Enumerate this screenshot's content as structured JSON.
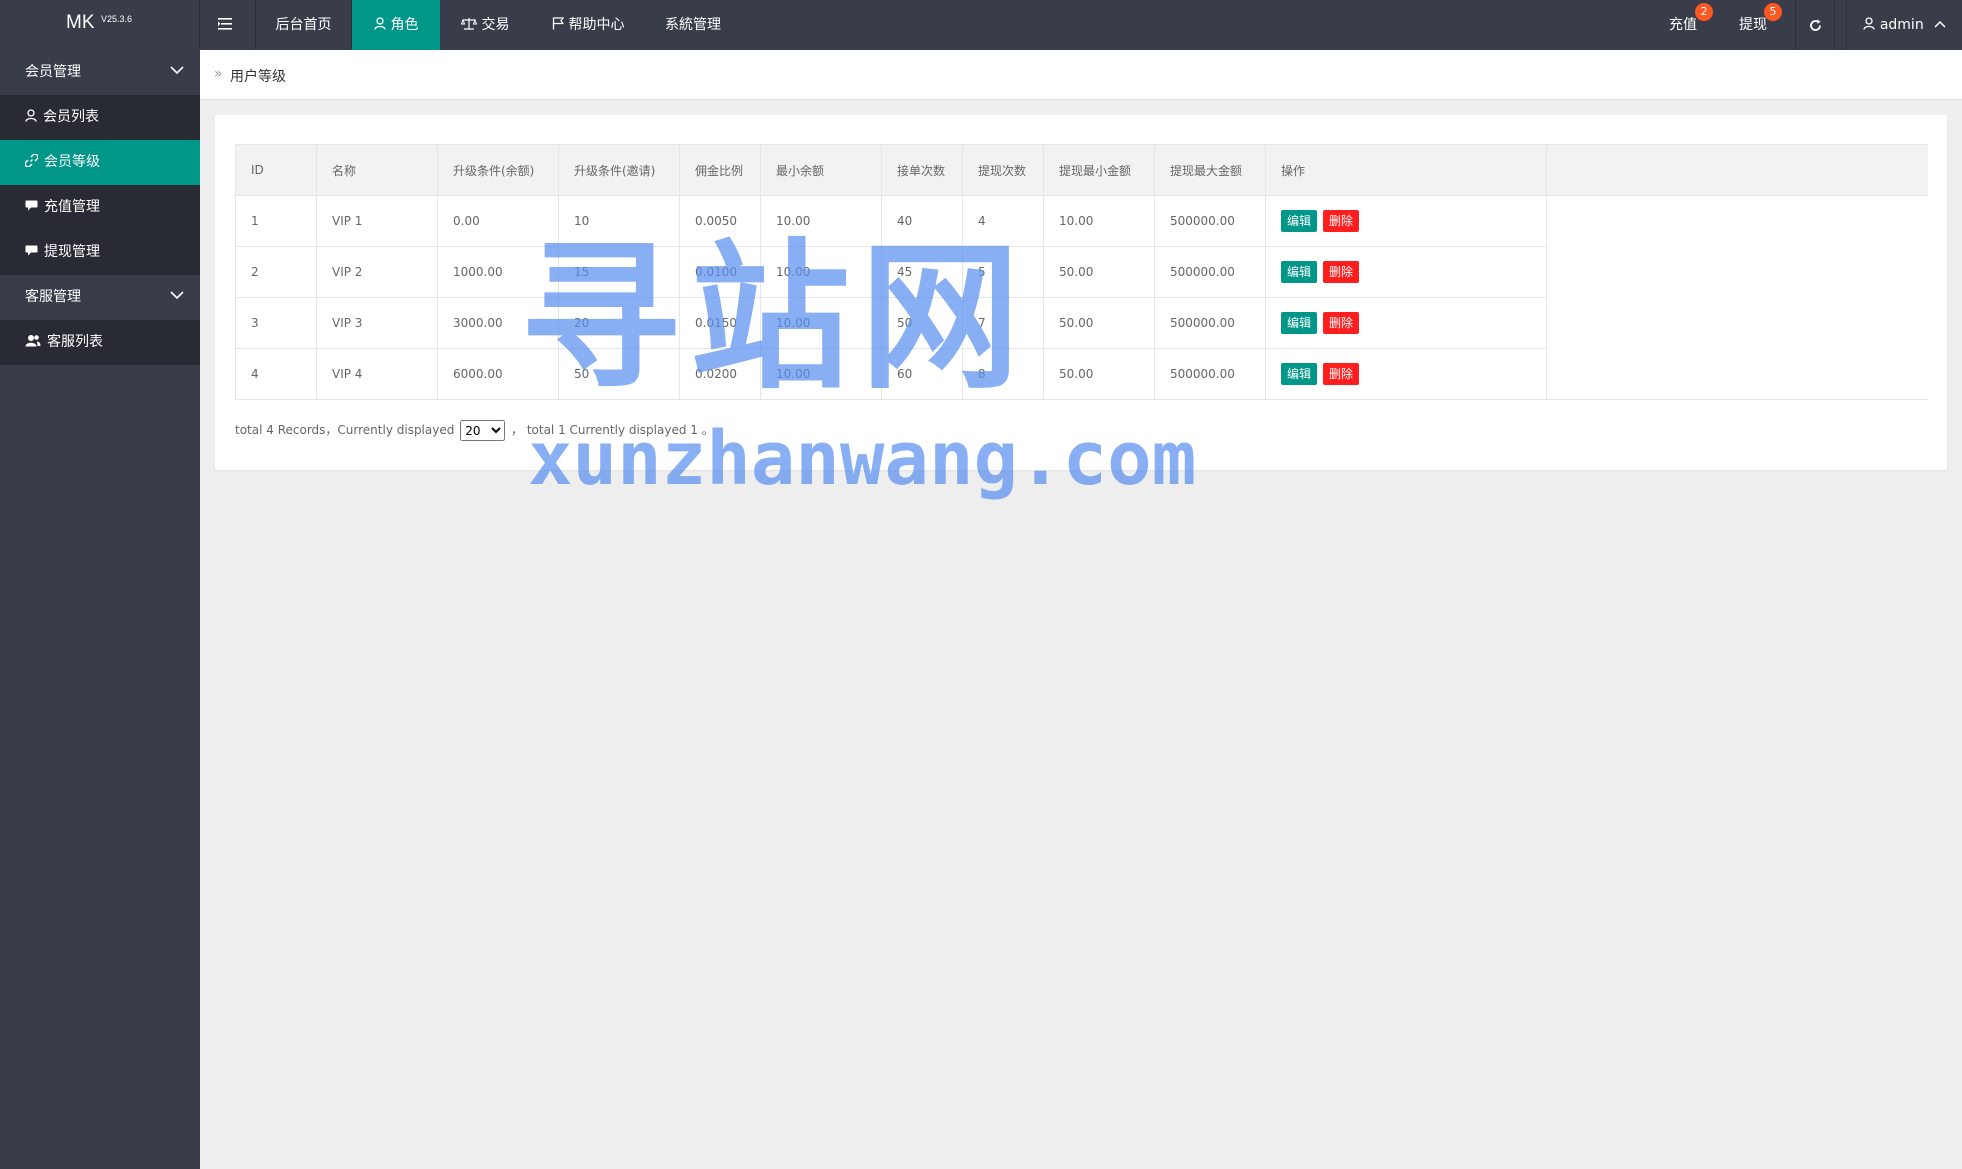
{
  "app": {
    "name": "MK",
    "version": "V25.3.6"
  },
  "topnav": {
    "home": "后台首页",
    "role": "角色",
    "trade": "交易",
    "help": "帮助中心",
    "system": "系統管理",
    "recharge": {
      "label": "充值",
      "badge": "2"
    },
    "withdraw": {
      "label": "提现",
      "badge": "5"
    },
    "user": "admin"
  },
  "sidebar": {
    "group1": "会员管理",
    "items1": [
      "会员列表",
      "会员等级",
      "充值管理",
      "提现管理"
    ],
    "group2": "客服管理",
    "items2": [
      "客服列表"
    ]
  },
  "breadcrumb": {
    "current": "用户等级"
  },
  "table": {
    "headers": [
      "ID",
      "名称",
      "升级条件(余额)",
      "升级条件(邀请)",
      "佣金比例",
      "最小余额",
      "接单次数",
      "提现次数",
      "提现最小金额",
      "提现最大金额",
      "操作"
    ],
    "rows": [
      [
        "1",
        "VIP 1",
        "0.00",
        "10",
        "0.0050",
        "10.00",
        "40",
        "4",
        "10.00",
        "500000.00"
      ],
      [
        "2",
        "VIP 2",
        "1000.00",
        "15",
        "0.0100",
        "10.00",
        "45",
        "5",
        "50.00",
        "500000.00"
      ],
      [
        "3",
        "VIP 3",
        "3000.00",
        "20",
        "0.0150",
        "10.00",
        "50",
        "7",
        "50.00",
        "500000.00"
      ],
      [
        "4",
        "VIP 4",
        "6000.00",
        "50",
        "0.0200",
        "10.00",
        "60",
        "8",
        "50.00",
        "500000.00"
      ]
    ],
    "edit_label": "编辑",
    "delete_label": "删除"
  },
  "pager": {
    "prefix": "total 4 Records，Currently displayed",
    "per_page": "20",
    "suffix": "， total 1 Currently displayed 1 。"
  },
  "watermark": {
    "cn": "寻站网",
    "en": "xunzhanwang.com"
  }
}
